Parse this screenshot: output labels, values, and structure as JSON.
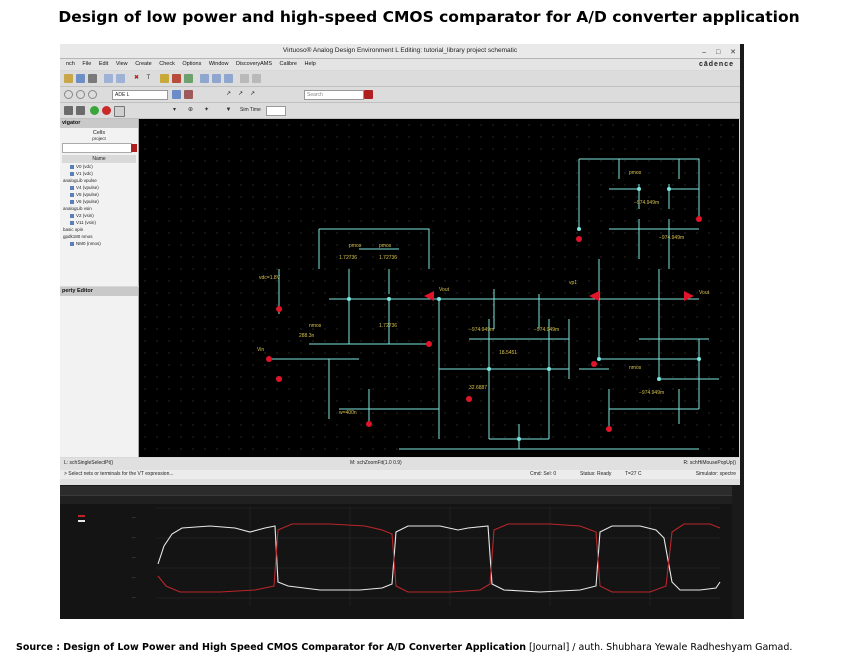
{
  "page": {
    "title": "Design of low power and high-speed CMOS comparator for A/D converter application",
    "source_label": "Source : Design of Low Power and High Speed CMOS Comparator for A/D Converter Application",
    "source_rest": " [Journal] / auth. Shubhara Yewale Radheshyam Gamad."
  },
  "window": {
    "title": "Virtuoso® Analog Design Environment L Editing: tutorial_library project schematic",
    "brand": "cādence",
    "menu": [
      "nch",
      "File",
      "Edit",
      "View",
      "Create",
      "Check",
      "Options",
      "Window",
      "DiscoveryAMS",
      "Calibre",
      "Help"
    ],
    "analysis_field": "ADE L",
    "search_placeholder": "Search",
    "simtime_label": "Sim Time"
  },
  "navigator": {
    "header": "vigator",
    "cells_label": "Cells",
    "project_label": "project",
    "column_name": "Name",
    "items": [
      {
        "label": "V0 (vdc)",
        "level": "sub"
      },
      {
        "label": "V1 (vdc)",
        "level": "sub"
      },
      {
        "label": "analogLib vpulse",
        "level": "top"
      },
      {
        "label": "V4 (vpulse)",
        "level": "sub"
      },
      {
        "label": "V5 (vpulse)",
        "level": "sub"
      },
      {
        "label": "V6 (vpulse)",
        "level": "sub"
      },
      {
        "label": "analogLib vsin",
        "level": "top"
      },
      {
        "label": "V2 (vsin)",
        "level": "sub"
      },
      {
        "label": "V11 (vsin)",
        "level": "sub"
      },
      {
        "label": "basic opin",
        "level": "top"
      },
      {
        "label": "gpdk180 nmos",
        "level": "top"
      },
      {
        "label": "NM0 (nmos)",
        "level": "sub"
      }
    ]
  },
  "property_editor": {
    "header": "perty Editor"
  },
  "status": {
    "left_top": "L: schSingleSelectPt()",
    "center_top": "M: schZoomFit(1.0 0.9)",
    "right_top": "R: schHiMousePopUp()",
    "left_bottom": "> Select nets or terminals for the VT expression...",
    "cmd": "Cmd: Sel: 0",
    "state": "Status: Ready",
    "temp": "T=27 C",
    "simulator": "Simulator: spectre"
  },
  "colors": {
    "wire": "#7ee6e0",
    "pin": "#e0152a",
    "label": "#d6c24a",
    "wave_white": "#e8e8e8",
    "wave_red": "#b8262a"
  },
  "schematic_labels": {
    "pmos": "pmos",
    "nmos": "nmos",
    "w400n": "w=400n",
    "v1_72": "1.72736",
    "v288": "288.3n",
    "vneg": "−974.949m",
    "v18": "18.5451",
    "v32": "32.6887",
    "vp1": "vp1",
    "vin": "Vin",
    "vout": "Vout",
    "vdc": "vdc=1.8V"
  }
}
